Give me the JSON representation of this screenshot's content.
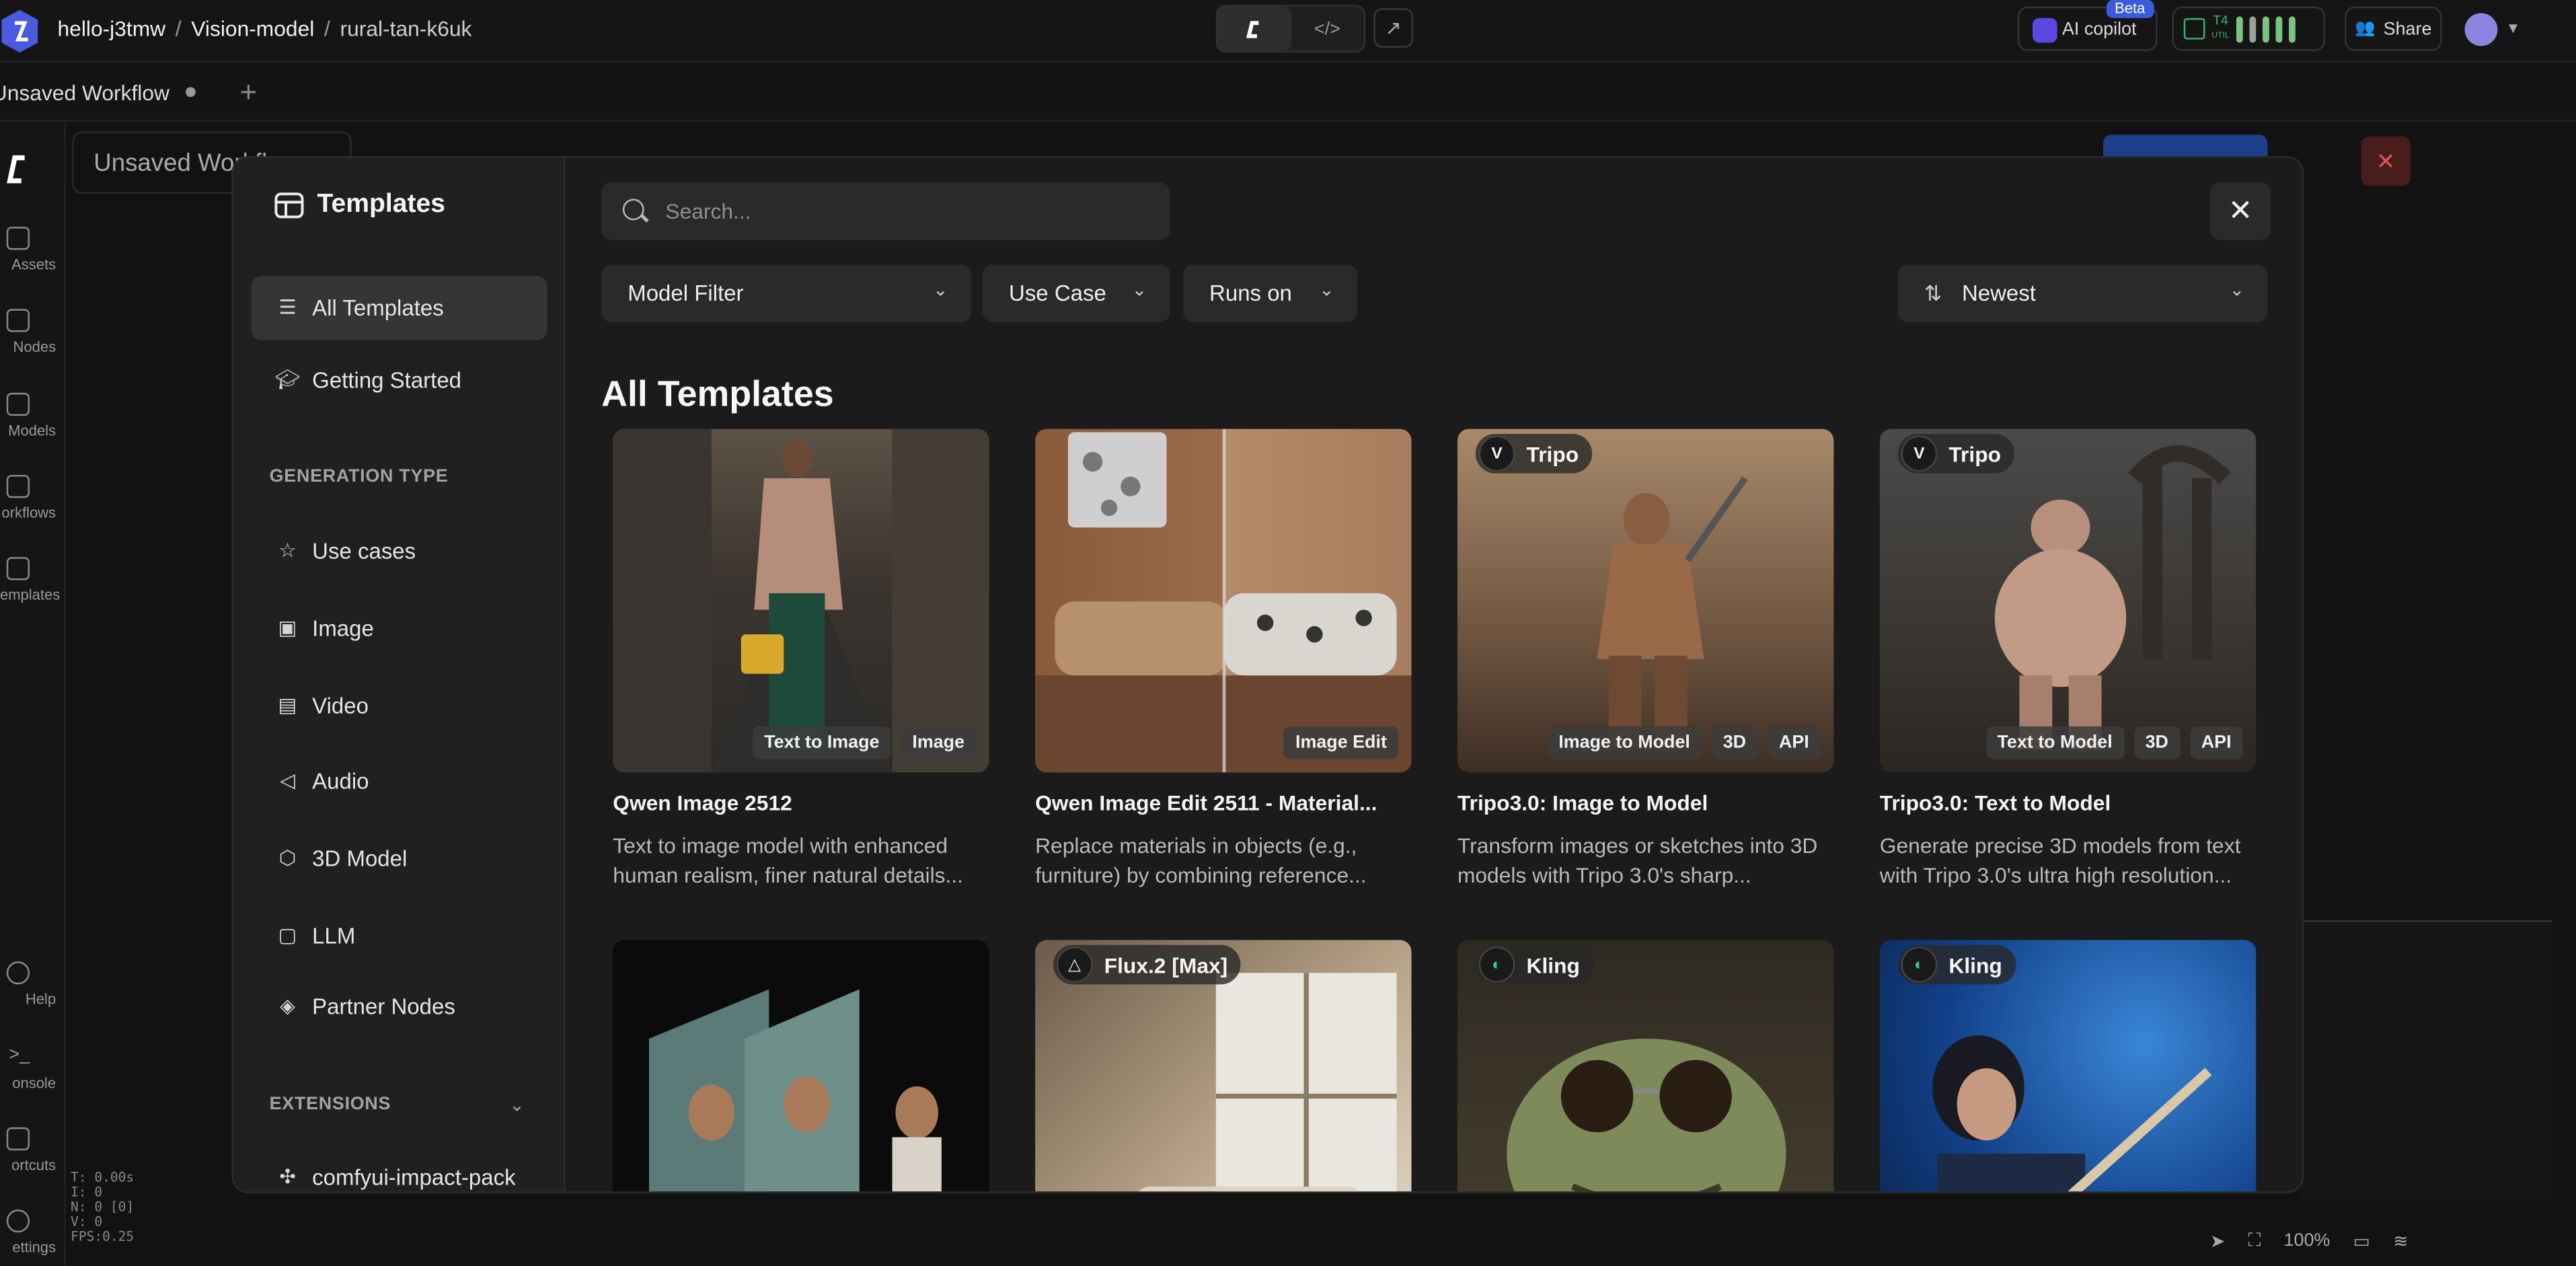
{
  "breadcrumb": {
    "workspace": "hello-j3tmw",
    "project": "Vision-model",
    "workflow": "rural-tan-k6uk",
    "separator": "/"
  },
  "topbar": {
    "copilot_label": "AI copilot",
    "beta_badge": "Beta",
    "share_label": "Share",
    "gpu_label": "T4",
    "gpu_util_label": "UTIL"
  },
  "tabs": {
    "current_label": "Unsaved Workflow"
  },
  "canvas": {
    "title": "Unsaved Workfl",
    "stats": [
      "T: 0.00s",
      "I: 0",
      "N: 0 [0]",
      "V: 0",
      "FPS:0.25"
    ],
    "zoom": "100%"
  },
  "rail": [
    {
      "label": "Assets",
      "icon": "image-icon"
    },
    {
      "label": "Nodes",
      "icon": "plug-icon"
    },
    {
      "label": "Models",
      "icon": "cube-icon"
    },
    {
      "label": "orkflows",
      "icon": "workflow-icon"
    },
    {
      "label": "emplates",
      "icon": "template-icon"
    },
    {
      "label": "Help",
      "icon": "help-icon"
    },
    {
      "label": "onsole",
      "icon": "console-icon"
    },
    {
      "label": "ortcuts",
      "icon": "keyboard-icon"
    },
    {
      "label": "ettings",
      "icon": "gear-icon"
    }
  ],
  "modal": {
    "title": "Templates",
    "search_placeholder": "Search...",
    "nav": [
      {
        "label": "All Templates",
        "icon": "list-icon",
        "active": true
      },
      {
        "label": "Getting Started",
        "icon": "graduation-cap-icon",
        "active": false
      }
    ],
    "generation_type_heading": "GENERATION TYPE",
    "generation_types": [
      {
        "label": "Use cases",
        "icon": "star-icon"
      },
      {
        "label": "Image",
        "icon": "image-icon"
      },
      {
        "label": "Video",
        "icon": "film-icon"
      },
      {
        "label": "Audio",
        "icon": "speaker-icon"
      },
      {
        "label": "3D Model",
        "icon": "cube-icon"
      },
      {
        "label": "LLM",
        "icon": "message-icon"
      },
      {
        "label": "Partner Nodes",
        "icon": "badge-icon"
      }
    ],
    "extensions_heading": "EXTENSIONS",
    "extensions": [
      {
        "label": "comfyui-impact-pack",
        "icon": "puzzle-icon"
      }
    ],
    "filters": {
      "model": "Model Filter",
      "use_case": "Use Case",
      "runs_on": "Runs on",
      "sort": "Newest"
    },
    "section_title": "All Templates",
    "cards": [
      {
        "title": "Qwen Image 2512",
        "desc": "Text to image model with enhanced human realism, finer natural details...",
        "tags": [
          "Text to Image",
          "Image"
        ],
        "brand": ""
      },
      {
        "title": "Qwen Image Edit 2511 - Material...",
        "desc": "Replace materials in objects (e.g., furniture) by combining reference...",
        "tags": [
          "Image Edit"
        ],
        "brand": ""
      },
      {
        "title": "Tripo3.0: Image to Model",
        "desc": "Transform images or sketches into 3D models with Tripo 3.0's sharp...",
        "tags": [
          "Image to Model",
          "3D",
          "API"
        ],
        "brand": "Tripo"
      },
      {
        "title": "Tripo3.0: Text to Model",
        "desc": "Generate precise 3D models from text with Tripo 3.0's ultra high resolution...",
        "tags": [
          "Text to Model",
          "3D",
          "API"
        ],
        "brand": "Tripo"
      },
      {
        "title": "",
        "desc": "",
        "tags": [],
        "brand": ""
      },
      {
        "title": "",
        "desc": "",
        "tags": [],
        "brand": "Flux.2 [Max]"
      },
      {
        "title": "",
        "desc": "",
        "tags": [],
        "brand": "Kling"
      },
      {
        "title": "",
        "desc": "",
        "tags": [],
        "brand": "Kling"
      }
    ]
  },
  "colors": {
    "accent": "#3b5bdb",
    "modal_bg": "#1b1b1b",
    "sidebar_bg": "#202020",
    "gpu_green": "#3bb56a"
  }
}
